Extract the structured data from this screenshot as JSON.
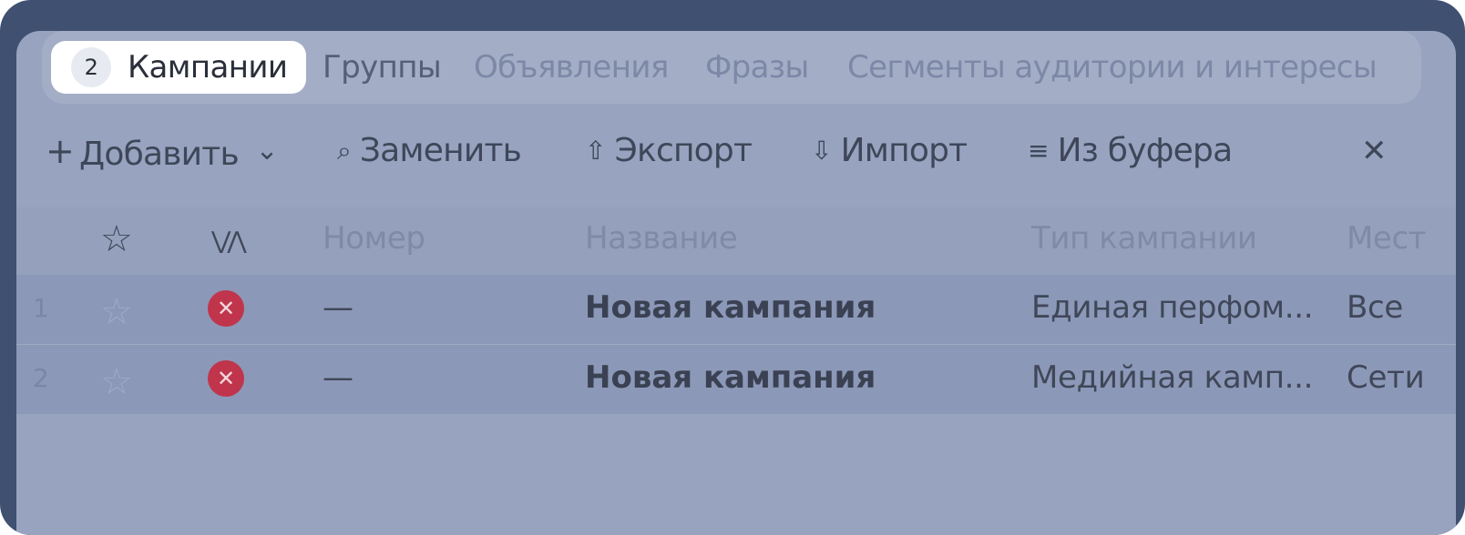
{
  "tabs": [
    {
      "label": "Кампании",
      "count": "2",
      "active": true
    },
    {
      "label": "Группы"
    },
    {
      "label": "Объявления"
    },
    {
      "label": "Фразы"
    },
    {
      "label": "Сегменты аудитории и интересы"
    }
  ],
  "toolbar": {
    "add": {
      "label": "Добавить",
      "icon": "+",
      "chevron": "⌄"
    },
    "replace": {
      "label": "Заменить",
      "icon": "⌕"
    },
    "export": {
      "label": "Экспорт",
      "icon": "⇧"
    },
    "import": {
      "label": "Импорт",
      "icon": "⇩"
    },
    "from_buffer": {
      "label": "Из буфера",
      "icon": "≡"
    },
    "close": "✕"
  },
  "table": {
    "columns": {
      "star": "☆",
      "status": "⋁⋀",
      "number": "Номер",
      "name": "Название",
      "type": "Тип кампании",
      "place": "Мест"
    },
    "rows": [
      {
        "index": "1",
        "number": "—",
        "name": "Новая кампания",
        "type": "Единая перфом...",
        "place": "Все"
      },
      {
        "index": "2",
        "number": "—",
        "name": "Новая кампания",
        "type": "Медийная камп...",
        "place": "Сети"
      }
    ]
  },
  "colors": {
    "frame": "#3f5071",
    "panel": "#98a3bf",
    "status_error": "#c0354b"
  }
}
